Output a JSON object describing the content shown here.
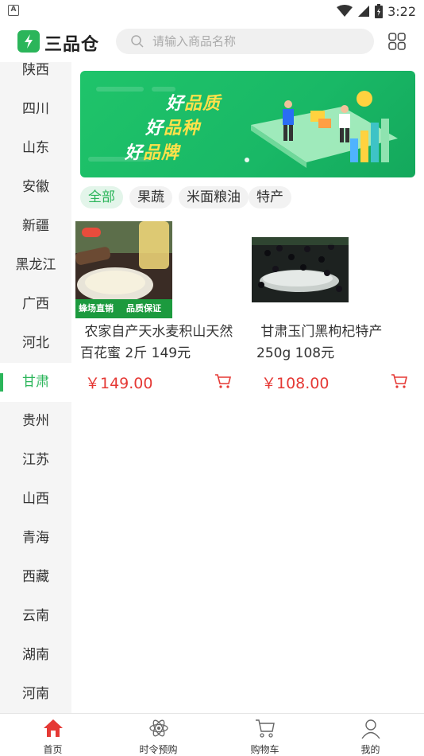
{
  "status_bar": {
    "time": "3:22",
    "left_badge": "A"
  },
  "header": {
    "app_title": "三品仓",
    "search_placeholder": "请输入商品名称"
  },
  "sidebar": {
    "items": [
      {
        "label": "陕西",
        "active": false
      },
      {
        "label": "四川",
        "active": false
      },
      {
        "label": "山东",
        "active": false
      },
      {
        "label": "安徽",
        "active": false
      },
      {
        "label": "新疆",
        "active": false
      },
      {
        "label": "黑龙江",
        "active": false
      },
      {
        "label": "广西",
        "active": false
      },
      {
        "label": "河北",
        "active": false
      },
      {
        "label": "甘肃",
        "active": true
      },
      {
        "label": "贵州",
        "active": false
      },
      {
        "label": "江苏",
        "active": false
      },
      {
        "label": "山西",
        "active": false
      },
      {
        "label": "青海",
        "active": false
      },
      {
        "label": "西藏",
        "active": false
      },
      {
        "label": "云南",
        "active": false
      },
      {
        "label": "湖南",
        "active": false
      },
      {
        "label": "河南",
        "active": false
      }
    ]
  },
  "banner": {
    "line1_prefix": "好",
    "line1_highlight": "品质",
    "line2_prefix": "好",
    "line2_highlight": "品种",
    "line3_prefix": "好",
    "line3_highlight": "品牌"
  },
  "tabs": [
    {
      "label": "全部",
      "active": true
    },
    {
      "label": "果蔬",
      "active": false
    },
    {
      "label": "米面粮油",
      "active": false
    },
    {
      "label": "特产",
      "active": false
    }
  ],
  "products": [
    {
      "name": "农家自产天水麦积山天然百花蜜 2斤 149元",
      "name_line1": " 农家自产天水麦积山天然",
      "name_line2": "百花蜜 2斤 149元",
      "price": "￥149.00",
      "image_caption_left": "蜂场直销",
      "image_caption_right": "品质保证"
    },
    {
      "name": "甘肃玉门黑枸杞特产250g 108元",
      "name_line1": " 甘肃玉门黑枸杞特产",
      "name_line2": "250g 108元",
      "price": "￥108.00"
    }
  ],
  "bottom_nav": [
    {
      "label": "首页",
      "icon": "home-icon",
      "active": true
    },
    {
      "label": "时令预购",
      "icon": "atom-icon",
      "active": false
    },
    {
      "label": "购物车",
      "icon": "cart-icon",
      "active": false
    },
    {
      "label": "我的",
      "icon": "user-icon",
      "active": false
    }
  ],
  "colors": {
    "brand_green": "#2bb55a",
    "price_red": "#e53935",
    "home_red": "#e53935"
  }
}
